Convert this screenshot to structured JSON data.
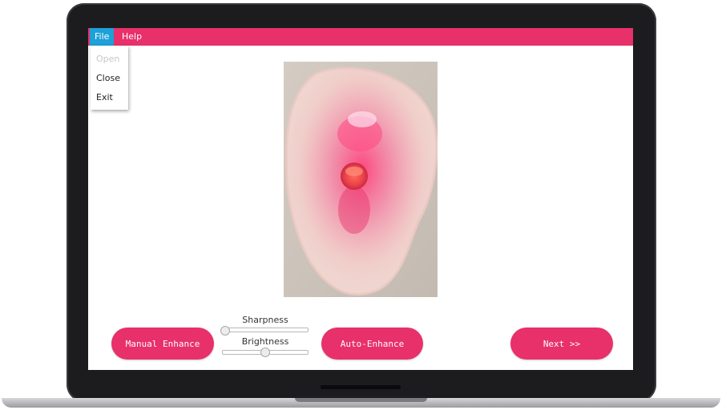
{
  "menubar": {
    "items": [
      {
        "label": "File",
        "active": true
      },
      {
        "label": "Help",
        "active": false
      }
    ],
    "color": "#e8306a",
    "active_color": "#1ea0d8"
  },
  "file_menu": {
    "items": [
      {
        "label": "Open",
        "enabled": false
      },
      {
        "label": "Close",
        "enabled": true
      },
      {
        "label": "Exit",
        "enabled": true
      }
    ]
  },
  "image": {
    "icon": "ear-mold-photo"
  },
  "sliders": {
    "sharpness": {
      "label": "Sharpness",
      "value": 0.0
    },
    "brightness": {
      "label": "Brightness",
      "value": 0.5
    }
  },
  "buttons": {
    "manual_enhance": "Manual Enhance",
    "auto_enhance": "Auto-Enhance",
    "next": "Next >>"
  }
}
